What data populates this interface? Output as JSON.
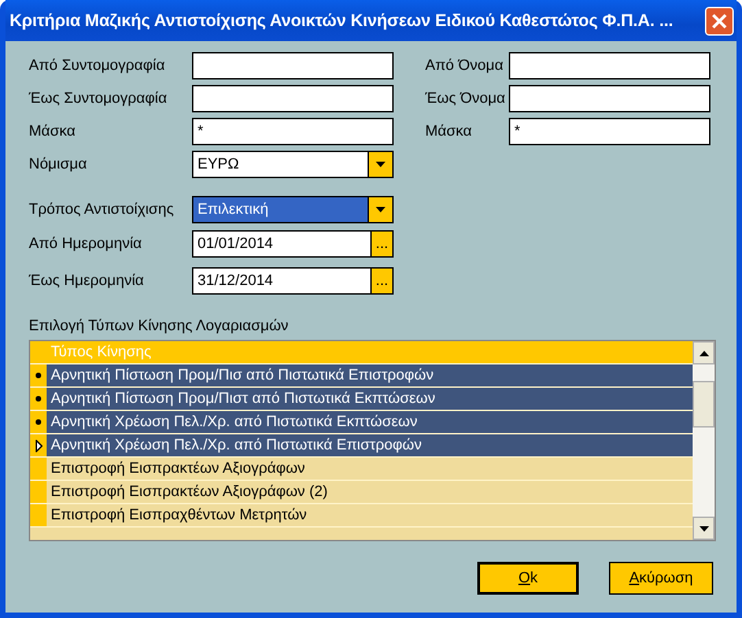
{
  "window": {
    "title": "Κριτήρια Μαζικής Αντιστοίχισης Ανοικτών Κινήσεων Ειδικού Καθεστώτος Φ.Π.Α. ..."
  },
  "left_fields": [
    {
      "label": "Από Συντομογραφία"
    },
    {
      "label": "Έως Συντομογραφία"
    },
    {
      "label": "Μάσκα",
      "value": "*"
    }
  ],
  "right_fields": [
    {
      "label": "Από Όνομα"
    },
    {
      "label": "Έως Όνομα"
    },
    {
      "label": "Μάσκα",
      "value": "*"
    }
  ],
  "currency": {
    "label": "Νόμισμα",
    "value": "ΕΥΡΩ",
    "focused": false
  },
  "matching_mode": {
    "label": "Τρόπος Αντιστοίχισης",
    "value": "Επιλεκτική",
    "focused": true
  },
  "dates": [
    {
      "label": "Από Ημερομηνία",
      "value": "01/01/2014",
      "button": "..."
    },
    {
      "label": "Έως Ημερομηνία",
      "value": "31/12/2014",
      "button": "..."
    }
  ],
  "grid": {
    "caption": "Επιλογή Τύπων Κίνησης Λογαριασμών",
    "columns": [
      "Τύπος Κίνησης"
    ],
    "rows": [
      {
        "text": "Αρνητική Πίστωση Προμ/Πισ από Πιστωτικά Επιστροφών",
        "selected": true,
        "current": false
      },
      {
        "text": "Αρνητική Πίστωση Προμ/Πιστ από Πιστωτικά Εκπτώσεων",
        "selected": true,
        "current": false
      },
      {
        "text": "Αρνητική Χρέωση Πελ./Χρ. από Πιστωτικά Εκπτώσεων",
        "selected": true,
        "current": false
      },
      {
        "text": "Αρνητική Χρέωση Πελ./Χρ. από Πιστωτικά Επιστροφών",
        "selected": true,
        "current": true
      },
      {
        "text": "Επιστροφή Εισπρακτέων Αξιογράφων",
        "selected": false,
        "current": false
      },
      {
        "text": "Επιστροφή Εισπρακτέων Αξιογράφων (2)",
        "selected": false,
        "current": false
      },
      {
        "text": "Επιστροφή Εισπραχθέντων Μετρητών",
        "selected": false,
        "current": false
      }
    ]
  },
  "buttons": [
    {
      "label": "Ok"
    },
    {
      "label": "Ακύρωση"
    }
  ]
}
